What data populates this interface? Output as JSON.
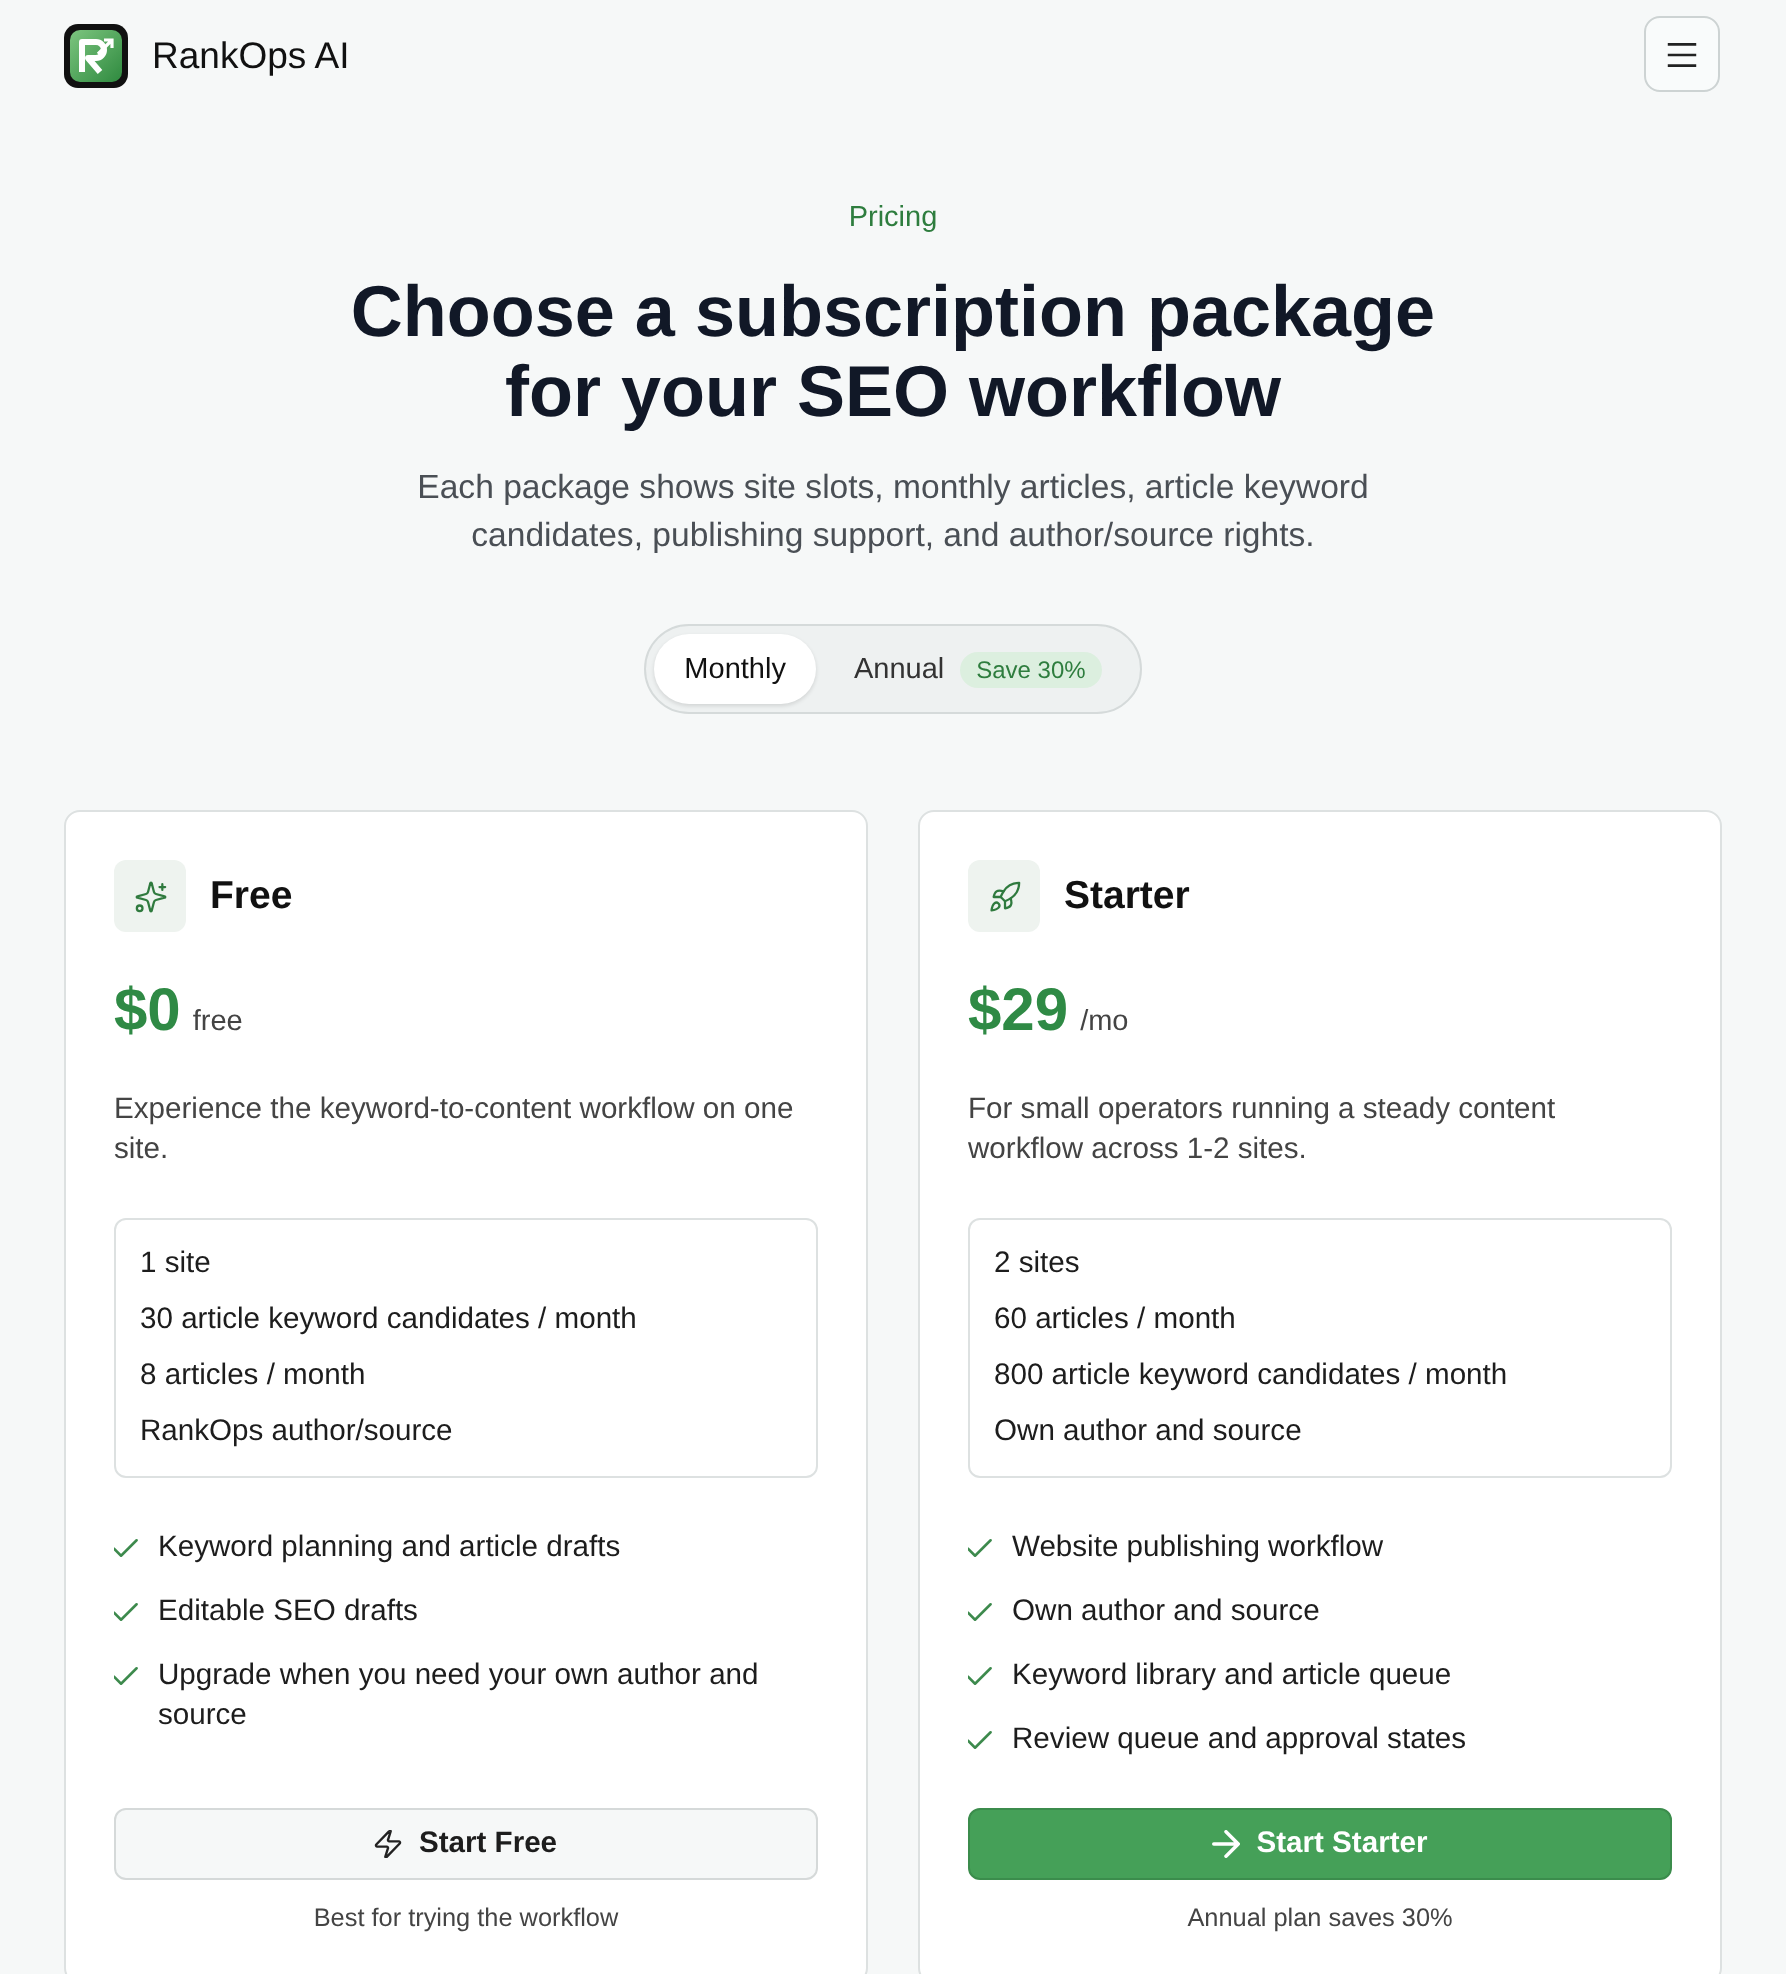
{
  "header": {
    "brand": "RankOps AI"
  },
  "hero": {
    "eyebrow": "Pricing",
    "title": "Choose a subscription package for your SEO workflow",
    "subtitle": "Each package shows site slots, monthly articles, article keyword candidates, publishing support, and author/source rights."
  },
  "billing_toggle": {
    "options": [
      {
        "label": "Monthly",
        "selected": true
      },
      {
        "label": "Annual",
        "selected": false,
        "badge": "Save 30%"
      }
    ]
  },
  "plans": [
    {
      "name": "Free",
      "price": "$0",
      "period": "free",
      "description": "Experience the keyword-to-content workflow on one site.",
      "limits": [
        "1 site",
        "30 article keyword candidates / month",
        "8 articles / month",
        "RankOps author/source"
      ],
      "features": [
        "Keyword planning and article drafts",
        "Editable SEO drafts",
        "Upgrade when you need your own author and source"
      ],
      "button": {
        "label": "Start Free",
        "primary": false
      },
      "note": "Best for trying the workflow"
    },
    {
      "name": "Starter",
      "price": "$29",
      "period": "/mo",
      "description": "For small operators running a steady content workflow across 1-2 sites.",
      "limits": [
        "2 sites",
        "60 articles / month",
        "800 article keyword candidates / month",
        "Own author and source"
      ],
      "features": [
        "Website publishing workflow",
        "Own author and source",
        "Keyword library and article queue",
        "Review queue and approval states"
      ],
      "button": {
        "label": "Start Starter",
        "primary": true
      },
      "note": "Annual plan saves 30%"
    }
  ]
}
